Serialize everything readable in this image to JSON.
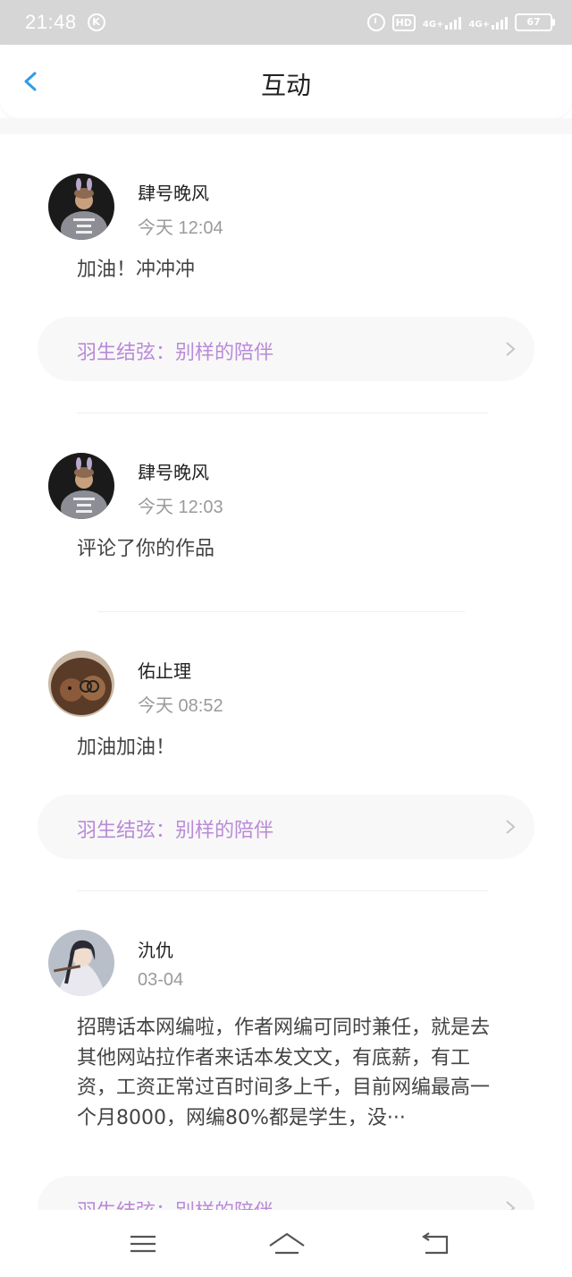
{
  "status_bar": {
    "time": "21:48",
    "k_badge": "K",
    "hd": "HD",
    "net1": "4G+",
    "net2": "4G+",
    "battery": "67"
  },
  "header": {
    "title": "互动"
  },
  "items": [
    {
      "name": "肆号晚风",
      "time": "今天 12:04",
      "body": "加油！冲冲冲",
      "work": "羽生结弦：别样的陪伴"
    },
    {
      "name": "肆号晚风",
      "time": "今天 12:03",
      "body": "评论了你的作品"
    },
    {
      "name": "佑止理",
      "time": "今天 08:52",
      "body": "加油加油！",
      "work": "羽生结弦：别样的陪伴"
    },
    {
      "name": "氿仇",
      "time": "03-04",
      "body": "招聘话本网编啦，作者网编可同时兼任，就是去其他网站拉作者来话本发文文，有底薪，有工资，工资正常过百时间多上千，目前网编最高一个月8000，网编80%都是学生，没···",
      "work": "羽生结弦：别样的陪伴"
    }
  ]
}
